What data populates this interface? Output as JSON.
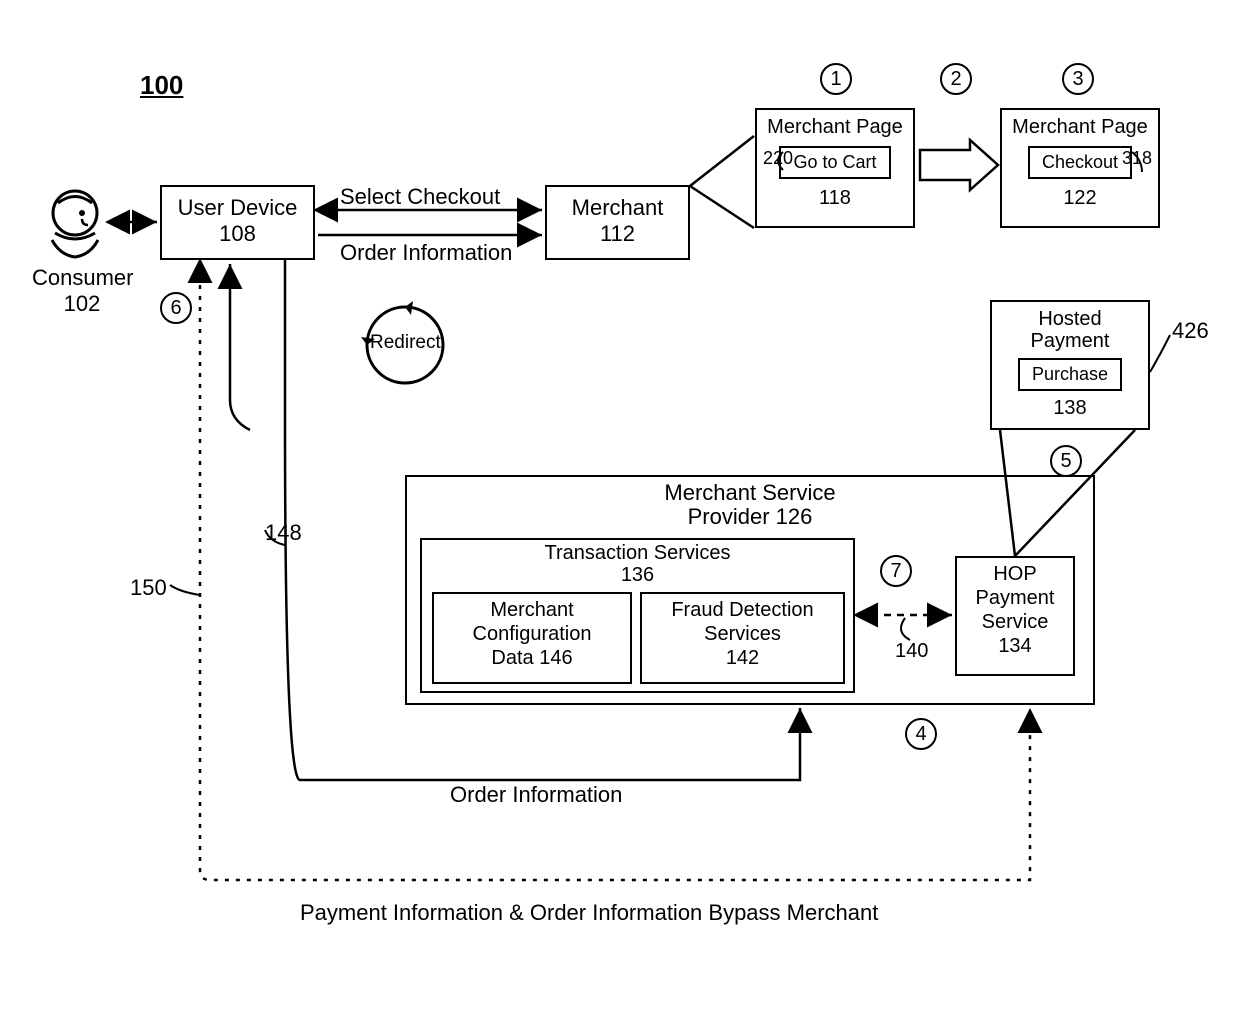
{
  "figure_number": "100",
  "consumer": {
    "label": "Consumer",
    "ref": "102"
  },
  "user_device": {
    "label": "User Device",
    "ref": "108"
  },
  "merchant": {
    "label": "Merchant",
    "ref": "112"
  },
  "select_checkout_label": "Select Checkout",
  "order_information_label": "Order Information",
  "redirect_label": "Redirect",
  "merchant_page_1": {
    "title": "Merchant Page",
    "button": "Go to Cart",
    "ref": "118",
    "inner_ref": "220"
  },
  "merchant_page_2": {
    "title": "Merchant Page",
    "button": "Checkout",
    "ref": "122",
    "inner_ref": "318"
  },
  "hosted_payment": {
    "title": "Hosted Payment",
    "button": "Purchase",
    "ref": "138",
    "inner_ref": "426"
  },
  "msp": {
    "title": "Merchant Service",
    "subtitle": "Provider 126",
    "transaction": {
      "title": "Transaction Services",
      "ref": "136"
    },
    "config": {
      "title_line1": "Merchant",
      "title_line2": "Configuration",
      "title_line3": "Data 146"
    },
    "fraud": {
      "title_line1": "Fraud Detection",
      "title_line2": "Services",
      "ref": "142"
    },
    "hop": {
      "line1": "HOP",
      "line2": "Payment",
      "line3": "Service",
      "ref": "134"
    },
    "link_ref": "140"
  },
  "path_148": "148",
  "path_150": "150",
  "bottom_order_info": "Order Information",
  "bottom_dotted": "Payment Information & Order Information Bypass Merchant",
  "steps": {
    "s1": "1",
    "s2": "2",
    "s3": "3",
    "s4": "4",
    "s5": "5",
    "s6": "6",
    "s7": "7"
  }
}
